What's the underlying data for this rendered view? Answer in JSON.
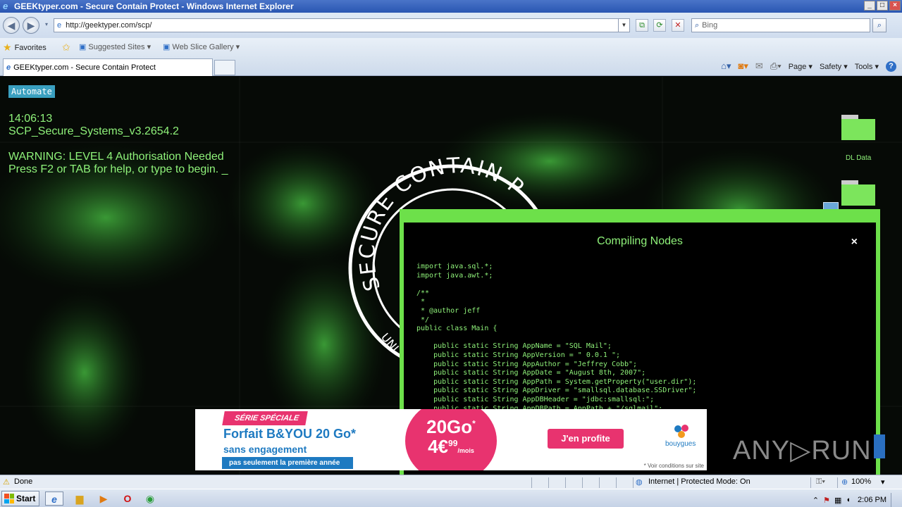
{
  "window": {
    "title": "GEEKtyper.com - Secure Contain Protect - Windows Internet Explorer",
    "controls": [
      "_",
      "□",
      "×"
    ]
  },
  "nav": {
    "address": "http://geektyper.com/scp/",
    "search_placeholder": "Bing"
  },
  "favorites_bar": {
    "favorites_label": "Favorites",
    "items": [
      "Suggested Sites ▾",
      "Web Slice Gallery ▾"
    ]
  },
  "tabs": [
    {
      "label": "GEEKtyper.com - Secure Contain Protect"
    }
  ],
  "command_bar": {
    "page": "Page ▾",
    "safety": "Safety ▾",
    "tools": "Tools ▾",
    "help": "?"
  },
  "content": {
    "automate_label": "Automate",
    "clock": "14:06:13",
    "system_name": "SCP_Secure_Systems_v3.2654.2",
    "warning": "WARNING: LEVEL 4 Authorisation Needed",
    "help_prompt": "Press F2 or TAB for help, or type to begin. _",
    "folders": [
      {
        "label": "DL Data"
      },
      {
        "label": ""
      }
    ],
    "seal_text": "SECURE CONTAIN P",
    "seal_sub": "UNI"
  },
  "modal": {
    "title": "Compiling Nodes",
    "close_label": "×",
    "code_lines": [
      "import java.sql.*;",
      "import java.awt.*;",
      "",
      "/**",
      " *",
      " * @author jeff",
      " */",
      "public class Main {",
      "",
      "    public static String AppName = \"SQL Mail\";",
      "    public static String AppVersion = \" 0.0.1 \";",
      "    public static String AppAuthor = \"Jeffrey Cobb\";",
      "    public static String AppDate = \"August 8th, 2007\";",
      "    public static String AppPath = System.getProperty(\"user.dir\");",
      "    public static String AppDriver = \"smallsql.database.SSDriver\";",
      "    public static String AppDBHeader = \"jdbc:smallsql:\";",
      "    public static String AppDBPath = AppPath + \"/sqlmail\";"
    ]
  },
  "ad": {
    "tag": "SÉRIE SPÉCIALE",
    "headline": "Forfait B&YOU 20 Go*",
    "subline": "sans engagement",
    "strip": "pas seulement la première année",
    "data_amount": "20Go",
    "data_star": "*",
    "price": "4€",
    "price_cents": "99",
    "price_unit": "/mois",
    "cta": "J'en profite",
    "brand": "bouygues",
    "disclaimer": "* Voir conditions sur site"
  },
  "watermark": "ANY▷RUN",
  "status": {
    "left": "Done",
    "zone": "Internet | Protected Mode: On",
    "zoom": "100%"
  },
  "taskbar": {
    "start": "Start",
    "time": "2:06 PM"
  },
  "colors": {
    "terminal_green": "#8ff27a",
    "modal_border": "#6de04a",
    "ad_pink": "#e8336f",
    "ad_blue": "#1e7ac1"
  }
}
